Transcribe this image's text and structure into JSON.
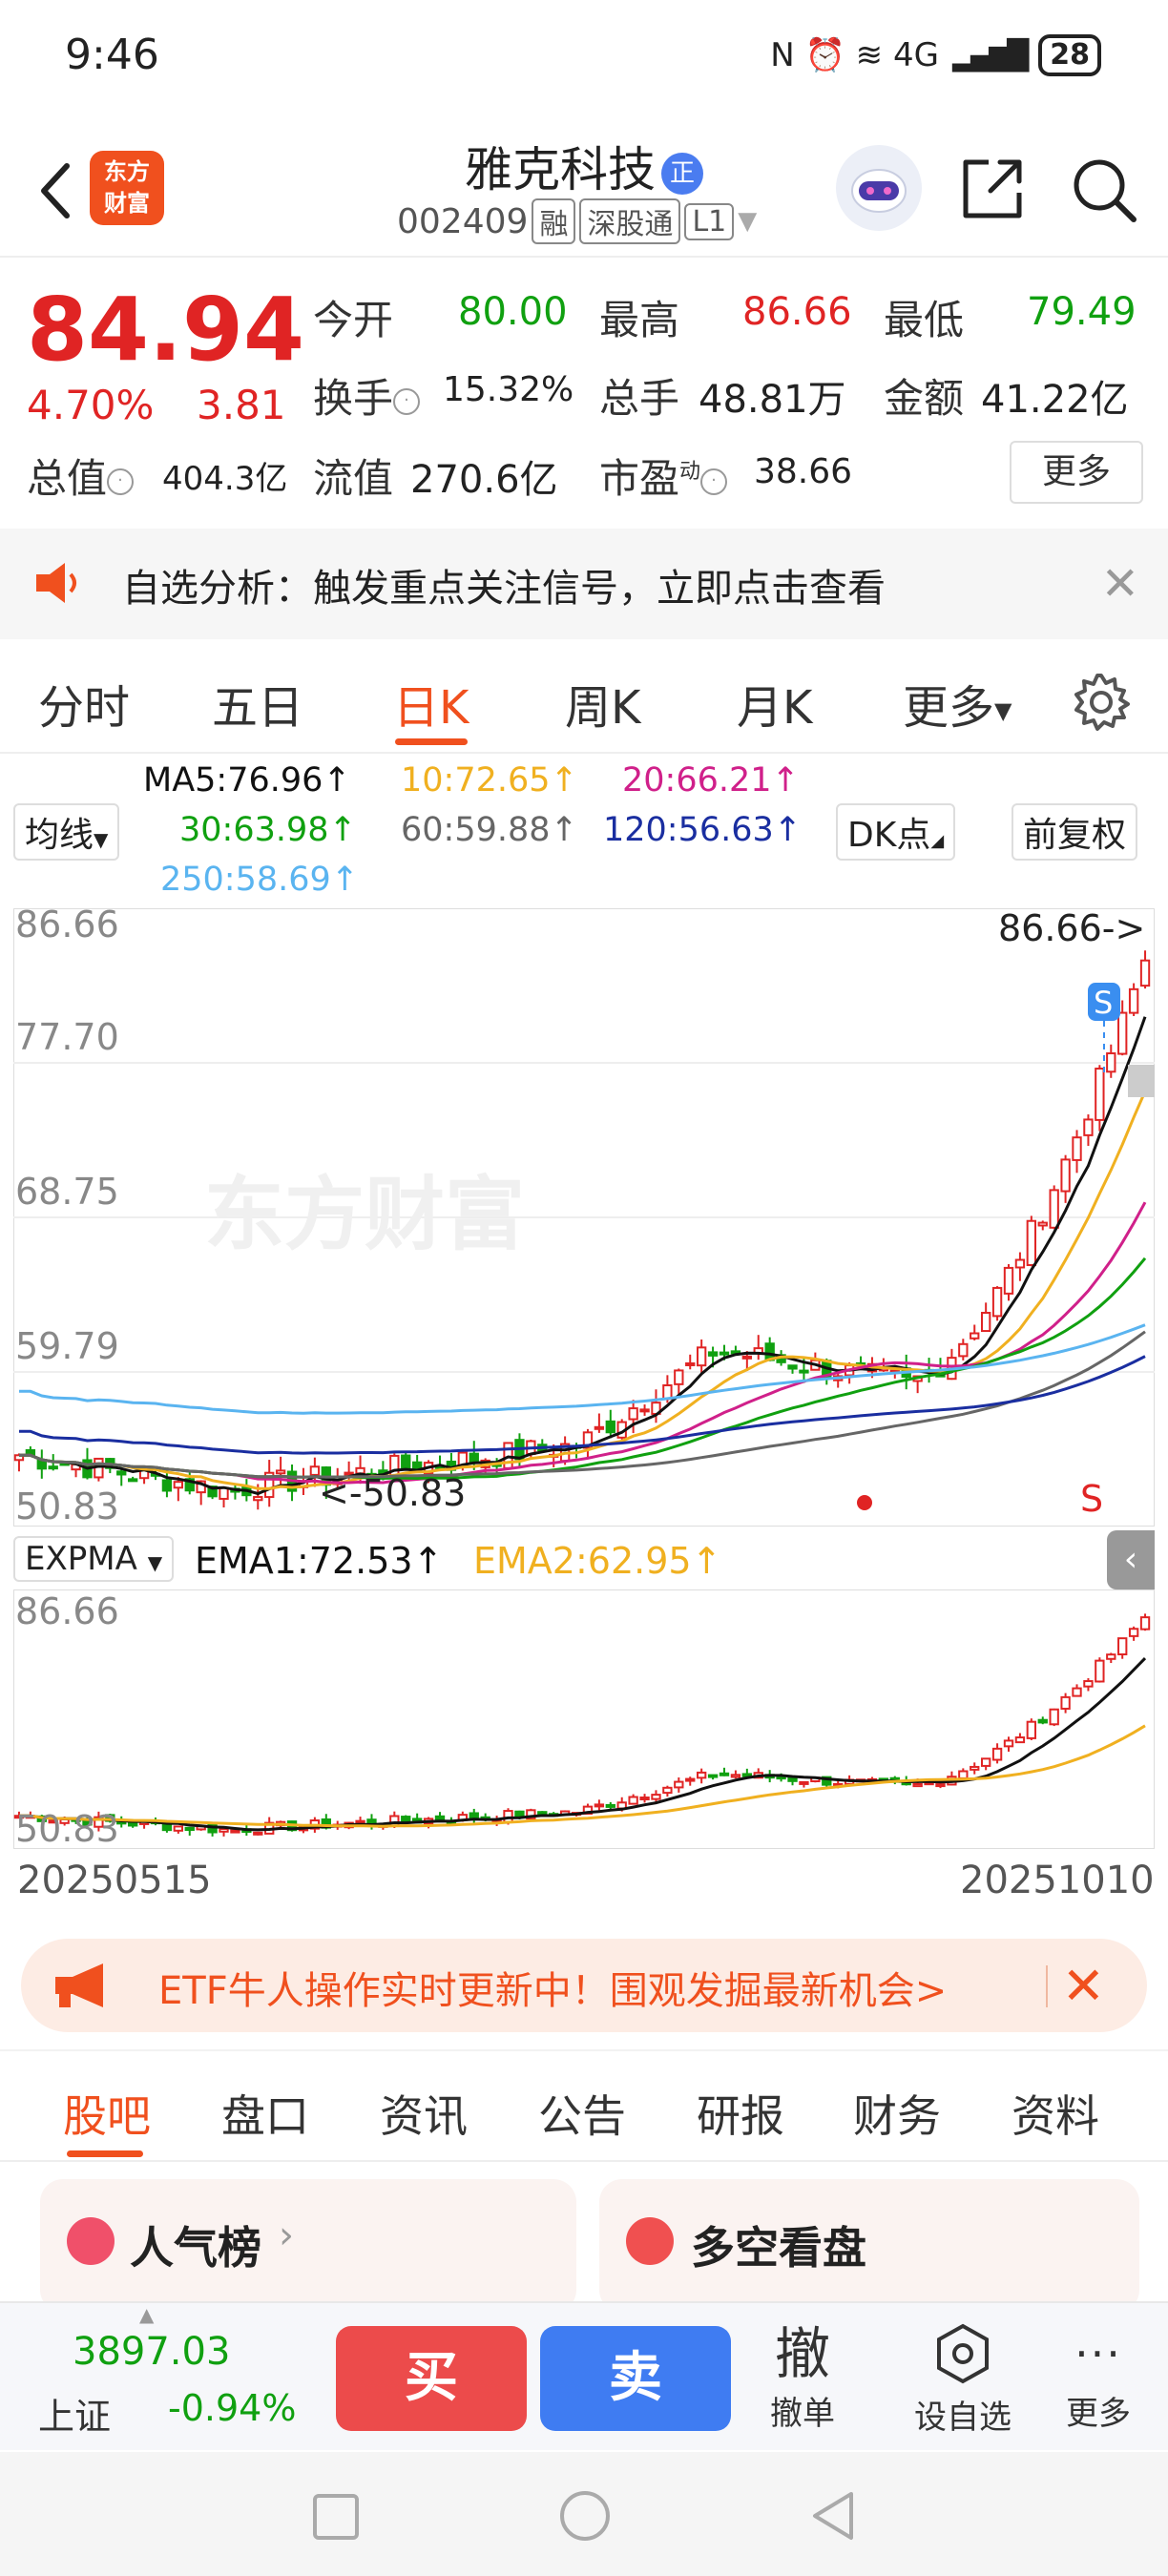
{
  "status_bar": {
    "time": "9:46",
    "signal_icons": "N ⏰ ≋ 4G",
    "battery": "28"
  },
  "header": {
    "logo_text_1": "东方",
    "logo_text_2": "财富",
    "stock_name": "雅克科技",
    "stock_badge": "正",
    "stock_code": "002409",
    "tag_margin": "融",
    "tag_connect": "深股通",
    "tag_level": "L1"
  },
  "quote": {
    "price": "84.94",
    "change_pct": "4.70%",
    "change_amt": "3.81",
    "open_label": "今开",
    "open": "80.00",
    "high_label": "最高",
    "high": "86.66",
    "low_label": "最低",
    "low": "79.49",
    "turnover_label": "换手",
    "turnover": "15.32%",
    "volume_label": "总手",
    "volume": "48.81万",
    "amount_label": "金额",
    "amount": "41.22亿",
    "mcap_label": "总值",
    "mcap": "404.3亿",
    "float_label": "流值",
    "float_cap": "270.6亿",
    "pe_label": "市盈",
    "pe_sup": "动",
    "pe": "38.66",
    "more": "更多"
  },
  "alert": {
    "text": "自选分析：触发重点关注信号，立即点击查看",
    "close": "✕"
  },
  "period_tabs": [
    "分时",
    "五日",
    "日K",
    "周K",
    "月K",
    "更多"
  ],
  "ma": {
    "selector": "均线",
    "ma5": "MA5:76.96↑",
    "ma10": "10:72.65↑",
    "ma20": "20:66.21↑",
    "ma30": "30:63.98↑",
    "ma60": "60:59.88↑",
    "ma120": "120:56.63↑",
    "ma250": "250:58.69↑",
    "dk_button": "DK点",
    "adjust_button": "前复权"
  },
  "chart_main": {
    "y_labels": [
      "86.66",
      "77.70",
      "68.75",
      "59.79",
      "50.83"
    ],
    "max_marker": "86.66->",
    "min_marker": "<-50.83",
    "watermark": "东方财富",
    "s_marker": "S",
    "s_marker2": "S"
  },
  "indicator": {
    "selector": "EXPMA",
    "ema1": "EMA1:72.53↑",
    "ema2": "EMA2:62.95↑",
    "y_top": "86.66",
    "y_bottom": "50.83"
  },
  "dates": {
    "start": "20250515",
    "end": "20251010"
  },
  "colors": {
    "up": "#e02424",
    "down": "#10a010",
    "ma5": "#111111",
    "ma10": "#f0b020",
    "ma20": "#d0208a",
    "ma30": "#10a010",
    "ma60": "#666666",
    "ma120": "#1a2ea0",
    "ma250": "#5ab4f0",
    "accent": "#f0501e"
  },
  "etf_banner": {
    "text": "ETF牛人操作实时更新中！围观发掘最新机会>",
    "close": "✕"
  },
  "content_tabs": [
    "股吧",
    "盘口",
    "资讯",
    "公告",
    "研报",
    "财务",
    "资料"
  ],
  "cards": {
    "left_title": "人气榜",
    "right_title": "多空看盘"
  },
  "trade_bar": {
    "index_value": "3897.03",
    "index_name": "上证",
    "index_pct": "-0.94%",
    "buy": "买",
    "sell": "卖",
    "cancel_icon": "撤",
    "cancel_label": "撤单",
    "watch_label": "设自选",
    "more_label": "更多"
  }
}
